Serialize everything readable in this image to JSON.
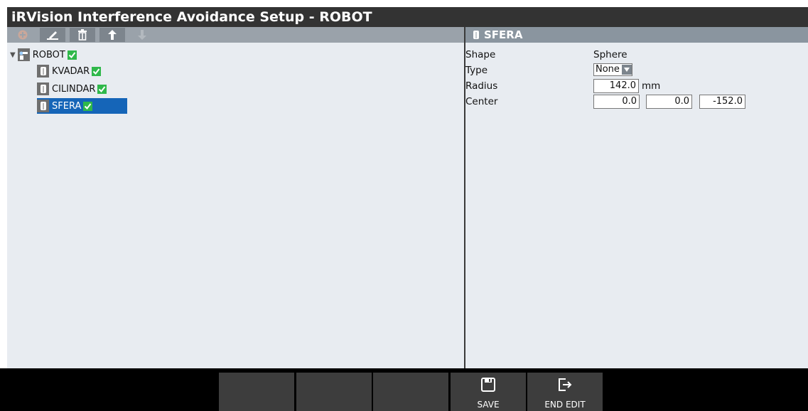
{
  "window": {
    "title": "iRVision Interference Avoidance Setup - ROBOT"
  },
  "toolbar": {
    "buttons": [
      {
        "icon": "add-circle-icon",
        "enabled": false
      },
      {
        "icon": "edit-pen-icon",
        "enabled": true
      },
      {
        "icon": "trash-icon",
        "enabled": true
      },
      {
        "icon": "arrow-up-icon",
        "enabled": true
      },
      {
        "icon": "arrow-down-icon",
        "enabled": false
      }
    ]
  },
  "tree": {
    "root": {
      "label": "ROBOT",
      "checked": true,
      "icon": "robot-icon",
      "expanded": true
    },
    "children": [
      {
        "label": "KVADAR",
        "checked": true,
        "icon": "cylinder-object-icon"
      },
      {
        "label": "CILINDAR",
        "checked": true,
        "icon": "cylinder-object-icon"
      },
      {
        "label": "SFERA",
        "checked": true,
        "icon": "cylinder-object-icon",
        "selected": true
      }
    ]
  },
  "detail": {
    "header": "SFERA",
    "shape": {
      "label": "Shape",
      "value": "Sphere"
    },
    "type": {
      "label": "Type",
      "value": "None"
    },
    "radius": {
      "label": "Radius",
      "value": "142.0",
      "unit": "mm"
    },
    "center": {
      "label": "Center",
      "x": "0.0",
      "y": "0.0",
      "z": "-152.0"
    }
  },
  "function_keys": [
    {
      "label": ""
    },
    {
      "label": ""
    },
    {
      "label": ""
    },
    {
      "label": "SAVE",
      "icon": "save-icon"
    },
    {
      "label": "END EDIT",
      "icon": "exit-icon"
    }
  ],
  "colors": {
    "title_bar": "#333333",
    "panel_bg": "#e8ecf1",
    "selection": "#1565b8",
    "check": "#2fb84a"
  }
}
